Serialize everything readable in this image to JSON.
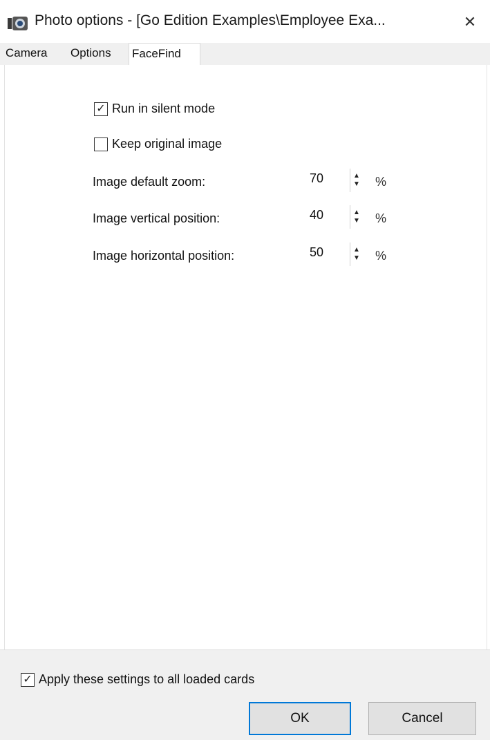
{
  "window": {
    "title": "Photo options - [Go Edition Examples\\Employee Exa...",
    "close_glyph": "✕"
  },
  "tabs": [
    {
      "label": "Camera"
    },
    {
      "label": "Options"
    },
    {
      "label": "FaceFind",
      "active": true
    }
  ],
  "facefind": {
    "silent_mode": {
      "label": "Run in silent mode",
      "checked": true
    },
    "keep_original": {
      "label": "Keep original image",
      "checked": false
    },
    "zoom": {
      "label": "Image default zoom:",
      "value": "70",
      "unit": "%"
    },
    "vertical": {
      "label": "Image vertical position:",
      "value": "40",
      "unit": "%"
    },
    "horizontal": {
      "label": "Image horizontal position:",
      "value": "50",
      "unit": "%"
    }
  },
  "footer": {
    "apply_all": {
      "label": "Apply these settings to all loaded cards",
      "checked": true
    },
    "ok_label": "OK",
    "cancel_label": "Cancel"
  },
  "colors": {
    "accent": "#0078d7"
  }
}
